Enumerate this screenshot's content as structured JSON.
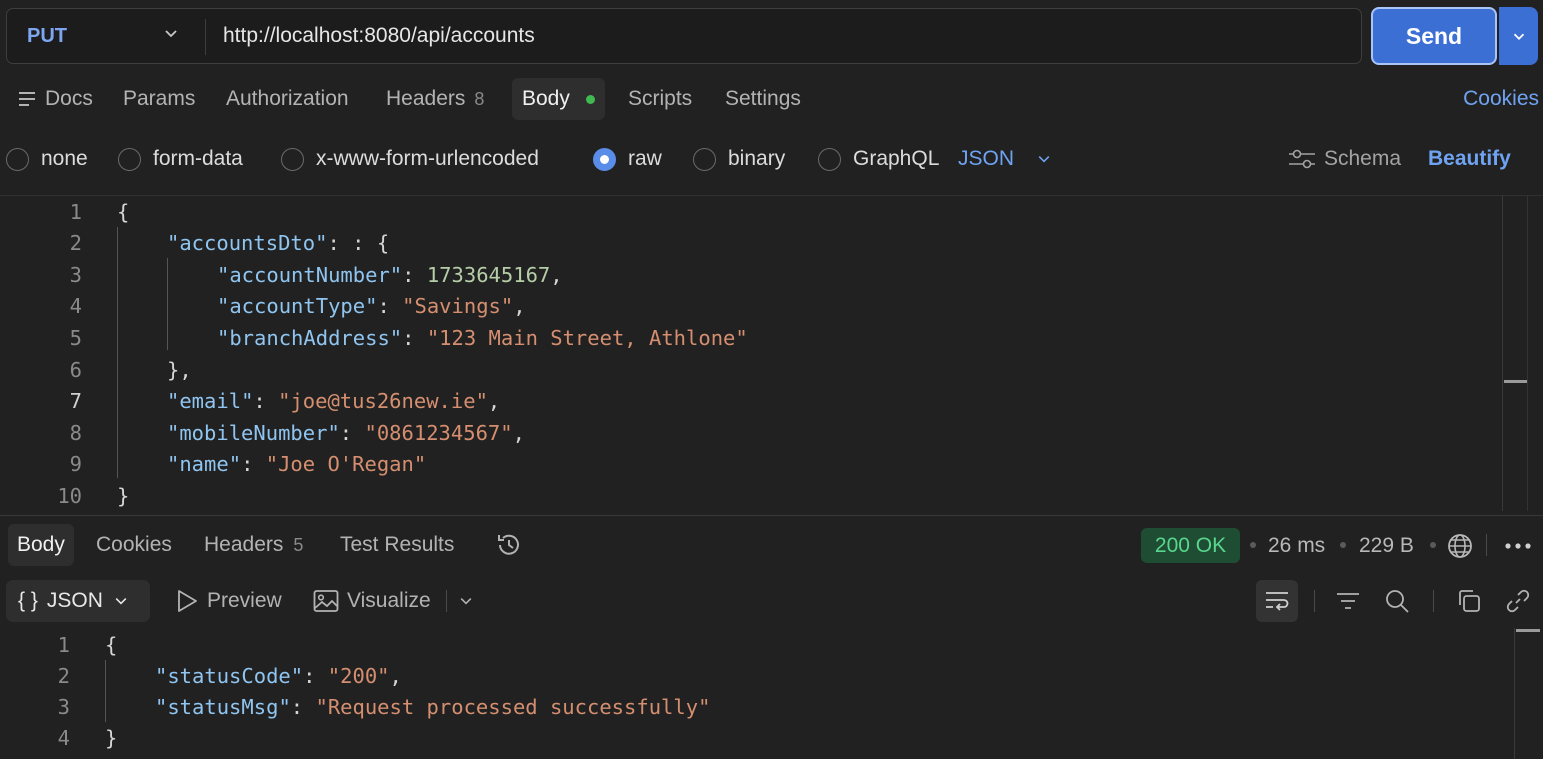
{
  "request": {
    "method": "PUT",
    "url": "http://localhost:8080/api/accounts",
    "send_label": "Send"
  },
  "request_tabs": {
    "docs": "Docs",
    "params": "Params",
    "authorization": "Authorization",
    "headers": "Headers",
    "headers_count": "8",
    "body": "Body",
    "scripts": "Scripts",
    "settings": "Settings",
    "cookies": "Cookies"
  },
  "body_types": {
    "none": "none",
    "form_data": "form-data",
    "urlencoded": "x-www-form-urlencoded",
    "raw": "raw",
    "binary": "binary",
    "graphql": "GraphQL",
    "selected": "raw",
    "format": "JSON",
    "schema": "Schema",
    "beautify": "Beautify"
  },
  "request_body": {
    "current_line": 7,
    "lines": [
      {
        "n": "1",
        "text": "{"
      },
      {
        "n": "2",
        "key": "accountsDto",
        "tail": ": {"
      },
      {
        "n": "3",
        "key": "accountNumber",
        "num": "1733645167",
        "tail": ","
      },
      {
        "n": "4",
        "key": "accountType",
        "str": "Savings",
        "tail": ","
      },
      {
        "n": "5",
        "key": "branchAddress",
        "str": "123 Main Street, Athlone",
        "tail": ""
      },
      {
        "n": "6",
        "text": "},"
      },
      {
        "n": "7",
        "key": "email",
        "str": "joe@tus26new.ie",
        "tail": ","
      },
      {
        "n": "8",
        "key": "mobileNumber",
        "str": "0861234567",
        "tail": ","
      },
      {
        "n": "9",
        "key": "name",
        "str": "Joe O'Regan",
        "tail": ""
      },
      {
        "n": "10",
        "text": "}"
      }
    ]
  },
  "response_tabs": {
    "body": "Body",
    "cookies": "Cookies",
    "headers": "Headers",
    "headers_count": "5",
    "test_results": "Test Results"
  },
  "response_meta": {
    "status": "200 OK",
    "time": "26 ms",
    "size": "229 B"
  },
  "response_toolbar": {
    "format": "JSON",
    "preview": "Preview",
    "visualize": "Visualize"
  },
  "response_body": {
    "lines": [
      {
        "n": "1",
        "text": "{"
      },
      {
        "n": "2",
        "key": "statusCode",
        "str": "200",
        "tail": ","
      },
      {
        "n": "3",
        "key": "statusMsg",
        "str": "Request processed successfully",
        "tail": ""
      },
      {
        "n": "4",
        "text": "}"
      }
    ]
  },
  "colors": {
    "accent": "#3b6fd4",
    "link": "#6fa3f2",
    "status_ok_bg": "#1f4d33",
    "status_ok_text": "#58d68d",
    "json_key": "#8fc5f0",
    "json_string": "#d58f70",
    "json_number": "#b5cea8"
  }
}
